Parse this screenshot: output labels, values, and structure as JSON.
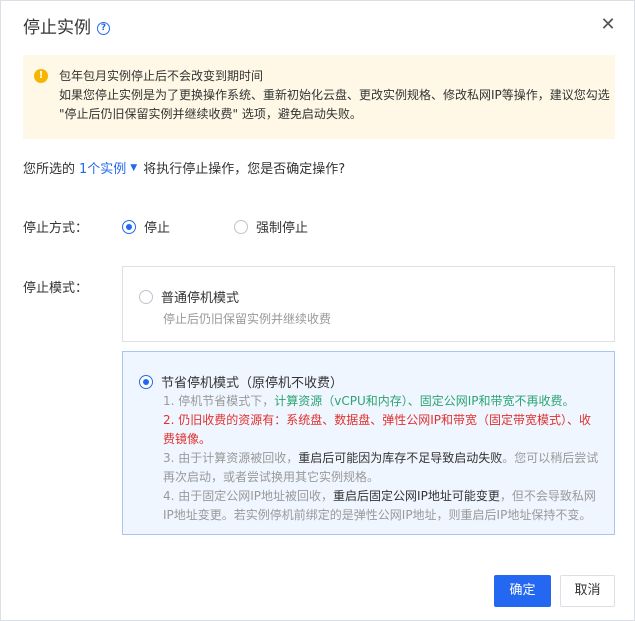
{
  "dialog": {
    "title": "停止实例",
    "help_icon": "question-circle-icon",
    "close_icon": "close-icon",
    "close_glyph": "✕"
  },
  "warning": {
    "icon": "warning-icon",
    "icon_glyph": "!",
    "line1": "包年包月实例停止后不会改变到期时间",
    "line2": "如果您停止实例是为了更换操作系统、重新初始化云盘、更改实例规格、修改私网IP等操作，建议您勾选",
    "line3": "\"停止后仍旧保留实例并继续收费\" 选项，避免启动失败。"
  },
  "confirm": {
    "prefix": "您所选的",
    "link": "1个实例",
    "caret": "▼",
    "suffix": "将执行停止操作，您是否确定操作?"
  },
  "stop_method": {
    "label": "停止方式：",
    "options": [
      {
        "label": "停止",
        "checked": true
      },
      {
        "label": "强制停止",
        "checked": false
      }
    ]
  },
  "stop_mode": {
    "label": "停止模式：",
    "normal": {
      "title": "普通停机模式",
      "subtitle": "停止后仍旧保留实例并继续收费",
      "checked": false
    },
    "saving": {
      "title": "节省停机模式（原停机不收费）",
      "checked": true,
      "note1_a": "1. 停机节省模式下，",
      "note1_b": "计算资源（vCPU和内存）、固定公网IP和带宽不再收费。",
      "note2_a": "2. 仍旧收费的资源有：系统盘、数据盘、弹性公网IP和带宽（固定带宽模式）、收",
      "note2_b": "费镜像。",
      "note3_a": "3. 由于计算资源被回收，",
      "note3_b": "重启后可能因为库存不足导致启动失败",
      "note3_c": "。您可以稍后尝试",
      "note3_d": "再次启动，或者尝试换用其它实例规格。",
      "note4_a": "4. 由于固定公网IP地址被回收，",
      "note4_b": "重启后固定公网IP地址可能变更",
      "note4_c": "，但不会导致私网",
      "note4_d": "IP地址变更。若实例停机前绑定的是弹性公网IP地址，则重启后IP地址保持不变。"
    }
  },
  "footer": {
    "ok_label": "确定",
    "cancel_label": "取消"
  },
  "colors": {
    "primary": "#2468f2",
    "warning_bg": "#fff8e6",
    "warning_icon": "#f7b500",
    "success_text": "#2ba471",
    "danger_text": "#e0312e"
  }
}
